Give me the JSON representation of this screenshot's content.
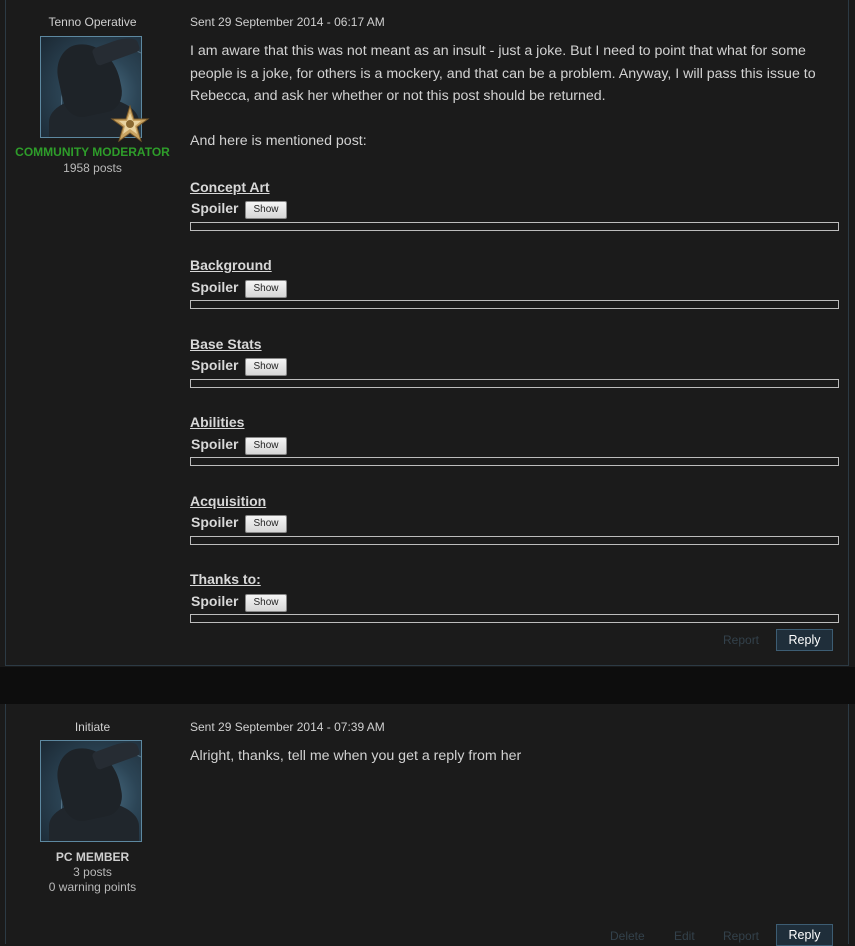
{
  "post1": {
    "author": {
      "rank": "Tenno Operative",
      "role": "COMMUNITY MODERATOR",
      "posts": "1958 posts"
    },
    "sent": "Sent 29 September 2014 - 06:17 AM",
    "paragraph1_lines": [
      "I am aware that this was not meant as an insult - just a joke. But I need to point that what for some",
      "people is a joke, for others is a mockery, and that can be a problem. Anyway, I will pass this issue to",
      "Rebecca, and ask her whether or not this post should be returned."
    ],
    "paragraph2": "And here is mentioned post:",
    "sections": [
      {
        "title": "Concept Art",
        "spoiler_label": "Spoiler",
        "button": "Show"
      },
      {
        "title": "Background",
        "spoiler_label": "Spoiler",
        "button": "Show"
      },
      {
        "title": "Base Stats",
        "spoiler_label": "Spoiler",
        "button": "Show"
      },
      {
        "title": "Abilities",
        "spoiler_label": "Spoiler",
        "button": "Show"
      },
      {
        "title": "Acquisition",
        "spoiler_label": "Spoiler",
        "button": "Show"
      },
      {
        "title": "Thanks to:",
        "spoiler_label": "Spoiler",
        "button": "Show"
      }
    ],
    "actions": {
      "report": "Report",
      "reply": "Reply"
    }
  },
  "post2": {
    "author": {
      "rank": "Initiate",
      "role": "PC MEMBER",
      "posts": "3 posts",
      "warnings": "0 warning points"
    },
    "sent": "Sent 29 September 2014 - 07:39 AM",
    "text": "Alright, thanks, tell me when you get a reply from her",
    "actions": {
      "delete": "Delete",
      "edit": "Edit",
      "report": "Report",
      "reply": "Reply"
    }
  },
  "colors": {
    "moderator_role": "#2e9d2a",
    "reply_button_bg": "#1f2e3a",
    "faint_link": "#33414b"
  },
  "icons": [
    "user-avatar",
    "moderator-star-badge"
  ]
}
